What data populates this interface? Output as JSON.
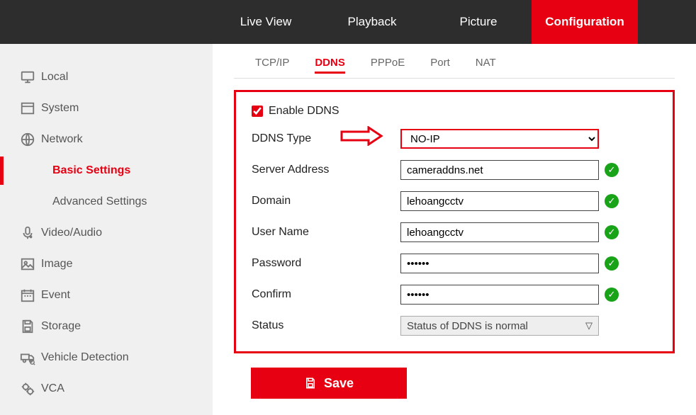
{
  "topnav": {
    "items": [
      {
        "label": "Live View",
        "active": false
      },
      {
        "label": "Playback",
        "active": false
      },
      {
        "label": "Picture",
        "active": false
      },
      {
        "label": "Configuration",
        "active": true
      }
    ]
  },
  "sidebar": {
    "items": [
      {
        "label": "Local",
        "icon": "monitor-icon"
      },
      {
        "label": "System",
        "icon": "window-icon"
      },
      {
        "label": "Network",
        "icon": "globe-icon"
      },
      {
        "label": "Basic Settings",
        "sub": true,
        "active": true
      },
      {
        "label": "Advanced Settings",
        "sub": true
      },
      {
        "label": "Video/Audio",
        "icon": "mic-icon"
      },
      {
        "label": "Image",
        "icon": "image-icon"
      },
      {
        "label": "Event",
        "icon": "calendar-icon"
      },
      {
        "label": "Storage",
        "icon": "save-icon"
      },
      {
        "label": "Vehicle Detection",
        "icon": "truck-icon"
      },
      {
        "label": "VCA",
        "icon": "gears-icon"
      }
    ]
  },
  "tabs": {
    "items": [
      {
        "label": "TCP/IP",
        "active": false
      },
      {
        "label": "DDNS",
        "active": true
      },
      {
        "label": "PPPoE",
        "active": false
      },
      {
        "label": "Port",
        "active": false
      },
      {
        "label": "NAT",
        "active": false
      }
    ]
  },
  "form": {
    "enable_label": "Enable DDNS",
    "enable_checked": true,
    "ddns_type_label": "DDNS Type",
    "ddns_type_value": "NO-IP",
    "server_address_label": "Server Address",
    "server_address_value": "cameraddns.net",
    "domain_label": "Domain",
    "domain_value": "lehoangcctv",
    "username_label": "User Name",
    "username_value": "lehoangcctv",
    "password_label": "Password",
    "password_value": "••••••",
    "confirm_label": "Confirm",
    "confirm_value": "••••••",
    "status_label": "Status",
    "status_value": "Status of DDNS is normal",
    "save_label": "Save"
  },
  "colors": {
    "accent": "#e60012",
    "ok": "#18a318"
  }
}
